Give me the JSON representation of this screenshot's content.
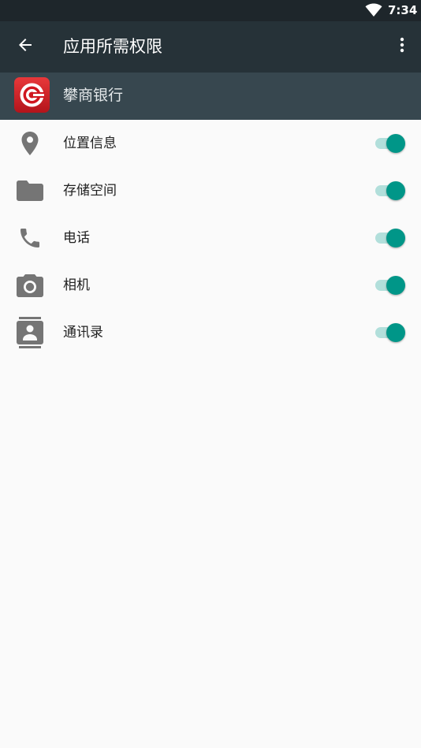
{
  "status_bar": {
    "time": "7:34",
    "wifi_icon": "wifi-icon"
  },
  "app_bar": {
    "title": "应用所需权限",
    "back_icon": "arrow-back-icon",
    "more_icon": "more-vert-icon"
  },
  "app_header": {
    "name": "攀商银行",
    "logo_icon": "bank-logo-icon"
  },
  "permissions": [
    {
      "label": "位置信息",
      "icon": "location-pin-icon",
      "enabled": true
    },
    {
      "label": "存储空间",
      "icon": "folder-icon",
      "enabled": true
    },
    {
      "label": "电话",
      "icon": "phone-icon",
      "enabled": true
    },
    {
      "label": "相机",
      "icon": "camera-icon",
      "enabled": true
    },
    {
      "label": "通讯录",
      "icon": "contacts-icon",
      "enabled": true
    }
  ],
  "colors": {
    "status_bar": "#1e262b",
    "app_bar": "#263238",
    "app_header": "#37474f",
    "background": "#fafafa",
    "switch_thumb": "#009688",
    "switch_track": "#b2dfdb",
    "icon": "#757575"
  }
}
